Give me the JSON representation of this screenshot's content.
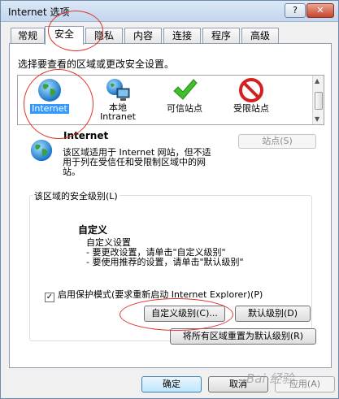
{
  "window": {
    "title": "Internet 选项",
    "help_label": "?",
    "close_label": "✕"
  },
  "tabs": [
    {
      "label": "常规"
    },
    {
      "label": "安全"
    },
    {
      "label": "隐私"
    },
    {
      "label": "内容"
    },
    {
      "label": "连接"
    },
    {
      "label": "程序"
    },
    {
      "label": "高级"
    }
  ],
  "active_tab": "安全",
  "zones": {
    "prompt": "选择要查看的区域或更改安全设置。",
    "items": [
      {
        "label": "Internet",
        "label2": "",
        "icon": "globe-icon",
        "selected": true
      },
      {
        "label": "本地",
        "label2": "Intranet",
        "icon": "local-intranet-icon",
        "selected": false
      },
      {
        "label": "可信站点",
        "label2": "",
        "icon": "check-icon",
        "selected": false
      },
      {
        "label": "受限站点",
        "label2": "",
        "icon": "no-entry-icon",
        "selected": false
      }
    ]
  },
  "zone_info": {
    "title": "Internet",
    "sites_button": "站点(S)",
    "description": "该区域适用于 Internet 网站，但不适用于列在受信任和受限制区域中的网站。"
  },
  "security_level": {
    "legend": "该区域的安全级别(L)",
    "title": "自定义",
    "lines": [
      "自定义设置",
      "- 要更改设置，请单击\"自定义级别\"",
      "- 要使用推荐的设置，请单击\"默认级别\""
    ]
  },
  "protected_mode": {
    "label": "启用保护模式(要求重新启动 Internet Explorer)(P)",
    "checked": true
  },
  "buttons": {
    "custom_level": "自定义级别(C)...",
    "default_level": "默认级别(D)",
    "reset_all": "将所有区域重置为默认级别(R)",
    "ok": "确定",
    "cancel": "取消",
    "apply": "应用(A)"
  },
  "watermark": "Bai 经验",
  "colors": {
    "selection": "#3399ff",
    "annotation": "#e0332d",
    "title_gradient_top": "#dbe8f6"
  }
}
